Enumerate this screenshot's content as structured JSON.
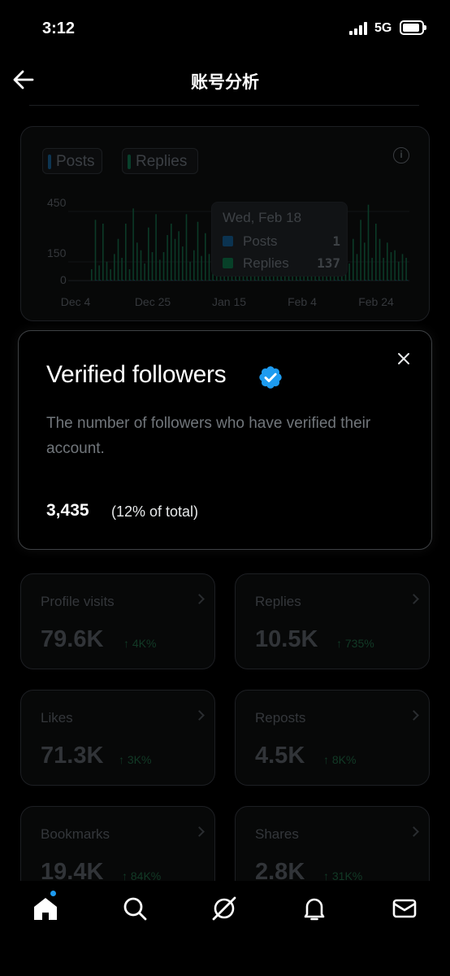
{
  "status_bar": {
    "time": "3:12",
    "network": "5G"
  },
  "header": {
    "title": "账号分析"
  },
  "activity_chart": {
    "legend": [
      {
        "label": "Posts",
        "color": "#1d9bf0"
      },
      {
        "label": "Replies",
        "color": "#00ba7c"
      }
    ],
    "y_ticks": [
      "450",
      "150",
      "0"
    ],
    "x_ticks": [
      "Dec 4",
      "Dec 25",
      "Jan 15",
      "Feb 4",
      "Feb 24"
    ],
    "tooltip": {
      "date": "Wed, Feb 18",
      "posts_label": "Posts",
      "posts_value": "1",
      "replies_label": "Replies",
      "replies_value": "137"
    }
  },
  "chart_data": {
    "type": "bar",
    "title": "",
    "xlabel": "",
    "ylabel": "",
    "ylim": [
      0,
      450
    ],
    "x_ticks": [
      "Dec 4",
      "Dec 25",
      "Jan 15",
      "Feb 4",
      "Feb 24"
    ],
    "series": [
      {
        "name": "Posts",
        "values": [
          0,
          2,
          1,
          0,
          3,
          1,
          0,
          2,
          1,
          0,
          1,
          2,
          0,
          1,
          0,
          2,
          1,
          0,
          1,
          3,
          0,
          1,
          2,
          0,
          1,
          0,
          1,
          2,
          0,
          1,
          0,
          2,
          1,
          0,
          1,
          2,
          0,
          1,
          3,
          0,
          1,
          2,
          0,
          1,
          0,
          1,
          2,
          1,
          0,
          1,
          2,
          0,
          1,
          0,
          2,
          1,
          0,
          1,
          0,
          1,
          2,
          0,
          1,
          0,
          1,
          2,
          1,
          0,
          1,
          0,
          1,
          0,
          2,
          1,
          0,
          1,
          1,
          0,
          1,
          0,
          1,
          2,
          0,
          1
        ]
      },
      {
        "name": "Replies",
        "values": [
          60,
          320,
          80,
          300,
          100,
          60,
          140,
          220,
          120,
          300,
          60,
          380,
          200,
          160,
          90,
          280,
          150,
          350,
          110,
          150,
          240,
          300,
          220,
          260,
          180,
          350,
          100,
          160,
          310,
          130,
          250,
          140,
          70,
          170,
          380,
          240,
          330,
          120,
          200,
          180,
          300,
          200,
          240,
          120,
          150,
          100,
          320,
          260,
          140,
          260,
          130,
          300,
          180,
          220,
          120,
          380,
          160,
          260,
          220,
          100,
          340,
          160,
          250,
          180,
          120,
          300,
          260,
          200,
          90,
          220,
          140,
          320,
          200,
          400,
          120,
          300,
          220,
          120,
          200,
          150,
          160,
          100,
          140,
          120
        ]
      }
    ]
  },
  "modal": {
    "title": "Verified followers",
    "description": "The number of followers who have verified their account.",
    "count": "3,435",
    "share": "(12% of total)"
  },
  "stats": [
    {
      "label": "Profile visits",
      "value": "79.6K",
      "delta": "↑ 4K%"
    },
    {
      "label": "Replies",
      "value": "10.5K",
      "delta": "↑ 735%"
    },
    {
      "label": "Likes",
      "value": "71.3K",
      "delta": "↑ 3K%"
    },
    {
      "label": "Reposts",
      "value": "4.5K",
      "delta": "↑ 8K%"
    },
    {
      "label": "Bookmarks",
      "value": "19.4K",
      "delta": "↑ 84K%"
    },
    {
      "label": "Shares",
      "value": "2.8K",
      "delta": "↑ 31K%"
    }
  ],
  "nav": [
    {
      "icon": "home-icon"
    },
    {
      "icon": "search-icon"
    },
    {
      "icon": "grok-icon"
    },
    {
      "icon": "bell-icon"
    },
    {
      "icon": "mail-icon"
    }
  ],
  "colors": {
    "accent": "#1d9bf0",
    "positive": "#00ba7c",
    "background": "#000000"
  }
}
